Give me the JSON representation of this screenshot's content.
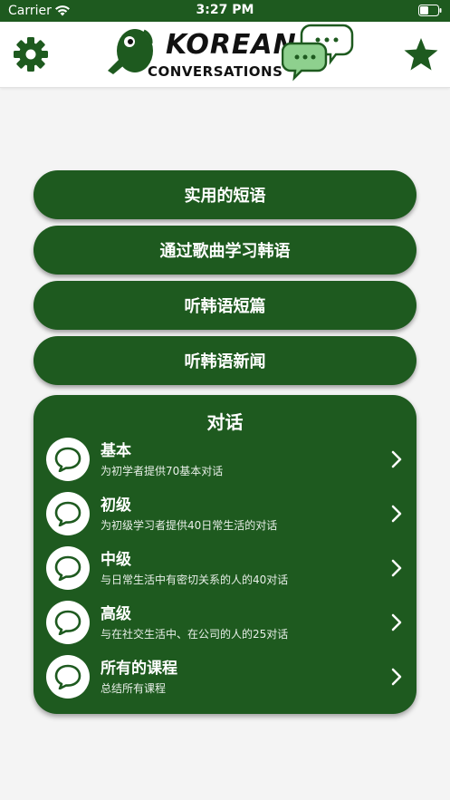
{
  "status_bar": {
    "carrier": "Carrier",
    "time": "3:27 PM"
  },
  "header": {
    "logo_line1": "KOREAN",
    "logo_line2": "CONVERSATIONS",
    "left_icon": "gear-icon",
    "right_icon": "star-icon"
  },
  "menu": [
    {
      "label": "实用的短语"
    },
    {
      "label": "通过歌曲学习韩语"
    },
    {
      "label": "听韩语短篇"
    },
    {
      "label": "听韩语新闻"
    }
  ],
  "conversations": {
    "title": "对话",
    "items": [
      {
        "title": "基本",
        "subtitle": "为初学者提供70基本对话"
      },
      {
        "title": "初级",
        "subtitle": "为初级学习者提供40日常生活的对话"
      },
      {
        "title": "中级",
        "subtitle": "与日常生活中有密切关系的人的40对话"
      },
      {
        "title": "高级",
        "subtitle": "与在社交生活中、在公司的人的25对话"
      },
      {
        "title": "所有的课程",
        "subtitle": "总结所有课程"
      }
    ]
  },
  "colors": {
    "brand_green": "#1e5a1f",
    "background": "#f4f4f4"
  }
}
